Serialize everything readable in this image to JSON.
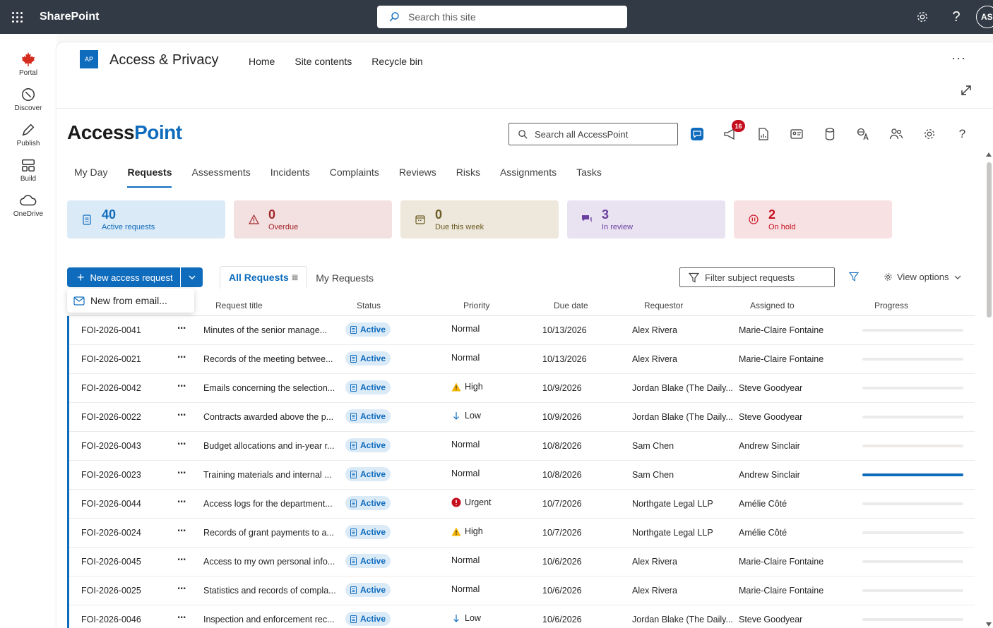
{
  "suite": {
    "title": "SharePoint",
    "search_placeholder": "Search this site",
    "avatar_initials": "AS"
  },
  "appbar": [
    {
      "label": "Portal",
      "icon": "maple-leaf-icon"
    },
    {
      "label": "Discover",
      "icon": "compass-icon"
    },
    {
      "label": "Publish",
      "icon": "pen-icon"
    },
    {
      "label": "Build",
      "icon": "layout-icon"
    },
    {
      "label": "OneDrive",
      "icon": "cloud-icon"
    }
  ],
  "site": {
    "logo_text": "AP",
    "name": "Access & Privacy",
    "nav": [
      "Home",
      "Site contents",
      "Recycle bin"
    ],
    "more_label": "···"
  },
  "app": {
    "brand_primary": "Access",
    "brand_accent": "Point",
    "search_placeholder": "Search all AccessPoint",
    "notification_count": "16",
    "tabs": [
      "My Day",
      "Requests",
      "Assessments",
      "Incidents",
      "Complaints",
      "Reviews",
      "Risks",
      "Assignments",
      "Tasks"
    ],
    "active_tab": "Requests"
  },
  "summary_cards": [
    {
      "value": "40",
      "label": "Active requests",
      "theme": "blue",
      "icon": "document-icon"
    },
    {
      "value": "0",
      "label": "Overdue",
      "theme": "red",
      "icon": "warning-icon"
    },
    {
      "value": "0",
      "label": "Due this week",
      "theme": "sand",
      "icon": "calendar-icon"
    },
    {
      "value": "3",
      "label": "In review",
      "theme": "purple",
      "icon": "chat-icon"
    },
    {
      "value": "2",
      "label": "On hold",
      "theme": "pink",
      "icon": "pause-icon"
    }
  ],
  "toolbar": {
    "new_button_label": "New access request",
    "menu_item_label": "New from email...",
    "view_tabs": [
      "All Requests",
      "My Requests"
    ],
    "filter_placeholder": "Filter subject requests",
    "view_options_label": "View options"
  },
  "table": {
    "columns": [
      "Request title",
      "Status",
      "Priority",
      "Due date",
      "Requestor",
      "Assigned to",
      "Progress"
    ],
    "rows": [
      {
        "id": "FOI-2026-0041",
        "title": "Minutes of the senior manage...",
        "status": "Active",
        "priority": "Normal",
        "priority_icon": "",
        "due": "10/13/2026",
        "requestor": "Alex Rivera",
        "assigned": "Marie-Claire Fontaine",
        "progress": 0
      },
      {
        "id": "FOI-2026-0021",
        "title": "Records of the meeting betwee...",
        "status": "Active",
        "priority": "Normal",
        "priority_icon": "",
        "due": "10/13/2026",
        "requestor": "Alex Rivera",
        "assigned": "Marie-Claire Fontaine",
        "progress": 0
      },
      {
        "id": "FOI-2026-0042",
        "title": "Emails concerning the selection...",
        "status": "Active",
        "priority": "High",
        "priority_icon": "warning",
        "due": "10/9/2026",
        "requestor": "Jordan Blake (The Daily...",
        "assigned": "Steve Goodyear",
        "progress": 0
      },
      {
        "id": "FOI-2026-0022",
        "title": "Contracts awarded above the p...",
        "status": "Active",
        "priority": "Low",
        "priority_icon": "arrow-down",
        "due": "10/9/2026",
        "requestor": "Jordan Blake (The Daily...",
        "assigned": "Steve Goodyear",
        "progress": 0
      },
      {
        "id": "FOI-2026-0043",
        "title": "Budget allocations and in-year r...",
        "status": "Active",
        "priority": "Normal",
        "priority_icon": "",
        "due": "10/8/2026",
        "requestor": "Sam Chen",
        "assigned": "Andrew Sinclair",
        "progress": 0
      },
      {
        "id": "FOI-2026-0023",
        "title": "Training materials and internal ...",
        "status": "Active",
        "priority": "Normal",
        "priority_icon": "",
        "due": "10/8/2026",
        "requestor": "Sam Chen",
        "assigned": "Andrew Sinclair",
        "progress": 1
      },
      {
        "id": "FOI-2026-0044",
        "title": "Access logs for the department...",
        "status": "Active",
        "priority": "Urgent",
        "priority_icon": "urgent",
        "due": "10/7/2026",
        "requestor": "Northgate Legal LLP",
        "assigned": "Amélie Côté",
        "progress": 0
      },
      {
        "id": "FOI-2026-0024",
        "title": "Records of grant payments to a...",
        "status": "Active",
        "priority": "High",
        "priority_icon": "warning",
        "due": "10/7/2026",
        "requestor": "Northgate Legal LLP",
        "assigned": "Amélie Côté",
        "progress": 0
      },
      {
        "id": "FOI-2026-0045",
        "title": "Access to my own personal info...",
        "status": "Active",
        "priority": "Normal",
        "priority_icon": "",
        "due": "10/6/2026",
        "requestor": "Alex Rivera",
        "assigned": "Marie-Claire Fontaine",
        "progress": 0
      },
      {
        "id": "FOI-2026-0025",
        "title": "Statistics and records of compla...",
        "status": "Active",
        "priority": "Normal",
        "priority_icon": "",
        "due": "10/6/2026",
        "requestor": "Alex Rivera",
        "assigned": "Marie-Claire Fontaine",
        "progress": 0
      },
      {
        "id": "FOI-2026-0046",
        "title": "Inspection and enforcement rec...",
        "status": "Active",
        "priority": "Low",
        "priority_icon": "arrow-down",
        "due": "10/6/2026",
        "requestor": "Jordan Blake (The Daily...",
        "assigned": "Steve Goodyear",
        "progress": 0
      }
    ]
  },
  "colors": {
    "accent": "#0f6cbd",
    "suitebar": "#323a45",
    "warning": "#f7b500",
    "urgent": "#c50f1f"
  }
}
